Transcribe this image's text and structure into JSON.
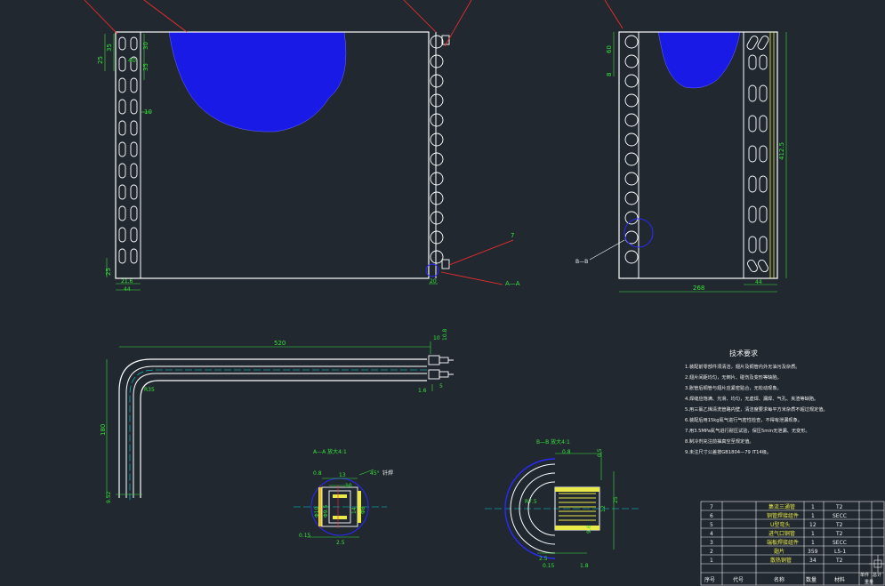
{
  "colors": {
    "background": "#212830",
    "outline": "#ffffff",
    "dimension": "#37e23a",
    "leader": "#ff2d2d",
    "centerline": "#00d8d8",
    "fins_hatch": "#1a1ae6",
    "section_circle": "#2a2aff",
    "thread": "#ffff33"
  },
  "front_view": {
    "dims": {
      "top_25": "25",
      "top_35": "35",
      "d40": "40",
      "d35": "35",
      "d30": "30",
      "d10": "10",
      "bottom_25": "25",
      "w21_6": "21.6",
      "w44": "44",
      "right_20": "20"
    },
    "callouts": {
      "item7": "7",
      "section_aa": "A—A"
    }
  },
  "side_view": {
    "dims": {
      "d60": "60",
      "d8": "8",
      "height": "412.5",
      "width": "268",
      "w44": "44"
    },
    "callout": "B—B"
  },
  "pipe_view": {
    "dims": {
      "length": "520",
      "d10": "10",
      "d10_8": "10.8",
      "d1_6": "1.6",
      "d5": "5",
      "radius": "R35",
      "height": "180",
      "bottom": "9.52"
    }
  },
  "section_aa": {
    "title": "A—A  放大4:1",
    "dims": {
      "d0_8": "0.8",
      "d13": "13",
      "d10": "10",
      "angle": "45°",
      "d0_15": "0.15",
      "d2_5": "2.5",
      "vertical": "Φ10",
      "v2": "Φ9.5",
      "v3": "14",
      "v4": "Φ8"
    },
    "label": "钎焊"
  },
  "section_bb": {
    "title": "B—B  放大4:1",
    "dims": {
      "d0_8": "0.8",
      "d0_5": "0.5",
      "d12": "12",
      "r": "R7.5",
      "d9_6": "9.6",
      "d2_5": "2.5",
      "d0_15": "0.15",
      "d1_8": "1.8",
      "d25": "25"
    }
  },
  "tech_requirements": {
    "title": "技术要求",
    "items": [
      "1.装配前零部件须清洁，翅片及铜管内外无油污及杂质。",
      "2.翅片间距均匀，无倒片、碰伤及变形等缺陷。",
      "3.胀管后铜管与翅片应紧密贴合，无松动现象。",
      "4.焊缝应饱满、光滑、均匀，无虚焊、漏焊、气孔、夹渣等缺陷。",
      "5.用三氯乙烯清洗管路内壁，清洁度要求每平方米杂质不超过规定值。",
      "6.装配后用15kg氮气进行气密性检查，不得有泄漏现象。",
      "7.用3.5MPa氮气进行耐压试验，保压5min无泄漏、无变形。",
      "8.制冷剂充注前抽真空至规定值。",
      "9.未注尺寸公差按GB1804—79 IT14级。"
    ]
  },
  "bom": {
    "rows": [
      {
        "no": "7",
        "name": "集流三通管",
        "qty": "1",
        "mat": "T2"
      },
      {
        "no": "6",
        "name": "铜管焊接组件",
        "qty": "1",
        "mat": "SECC"
      },
      {
        "no": "5",
        "name": "U型弯头",
        "qty": "12",
        "mat": "T2"
      },
      {
        "no": "4",
        "name": "进气口铜管",
        "qty": "1",
        "mat": "T2"
      },
      {
        "no": "3",
        "name": "端板焊接组件",
        "qty": "1",
        "mat": "SECC"
      },
      {
        "no": "2",
        "name": "翅片",
        "qty": "359",
        "mat": "L5-1"
      },
      {
        "no": "1",
        "name": "散热铜管",
        "qty": "34",
        "mat": "T2"
      }
    ],
    "header": {
      "no": "序号",
      "code": "代号",
      "name": "名称",
      "qty": "数量",
      "mat": "材料",
      "remark": "单件",
      "total": "总计",
      "weight": "重量"
    }
  }
}
